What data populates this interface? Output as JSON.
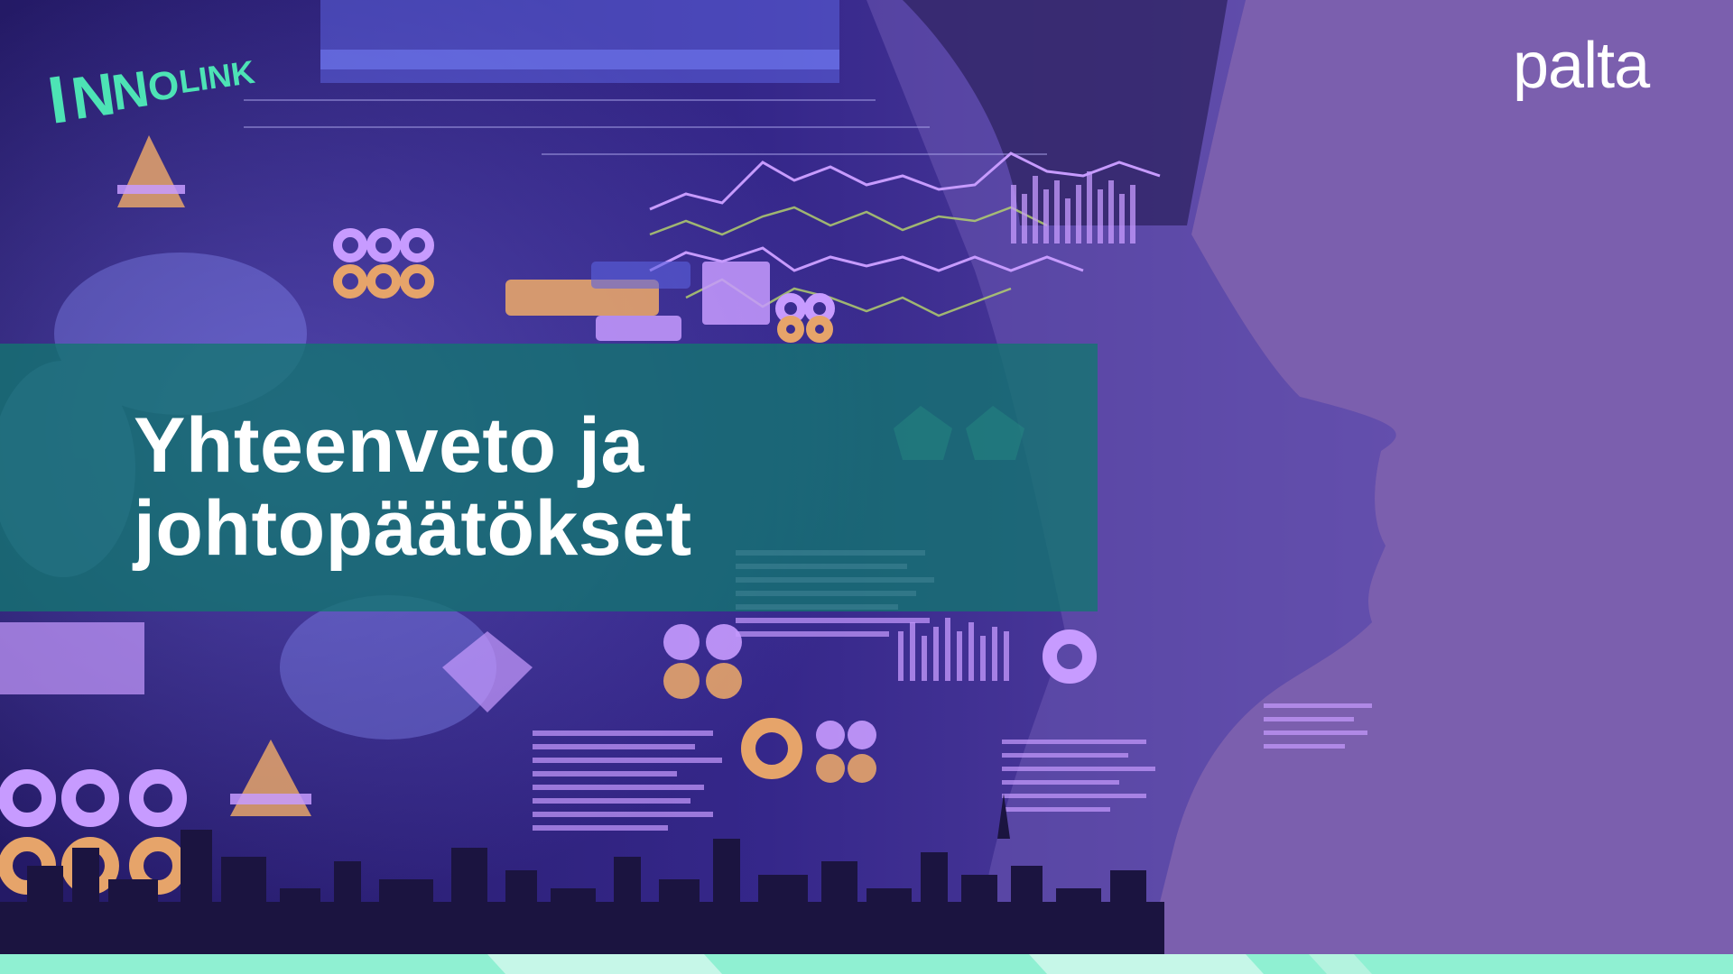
{
  "slide": {
    "title_line1": "Yhteenveto ja",
    "title_line2": "johtopäätökset"
  },
  "logos": {
    "left_brand": "INNOLINK",
    "right_brand": "palta"
  },
  "colors": {
    "background_purple": "#7b5fae",
    "collage_dark": "#2a1d6e",
    "title_band_teal": "#127670",
    "innolink_mint": "#4de3b5",
    "bottom_strip_mint": "#8ff0d2",
    "text_white": "#ffffff"
  }
}
